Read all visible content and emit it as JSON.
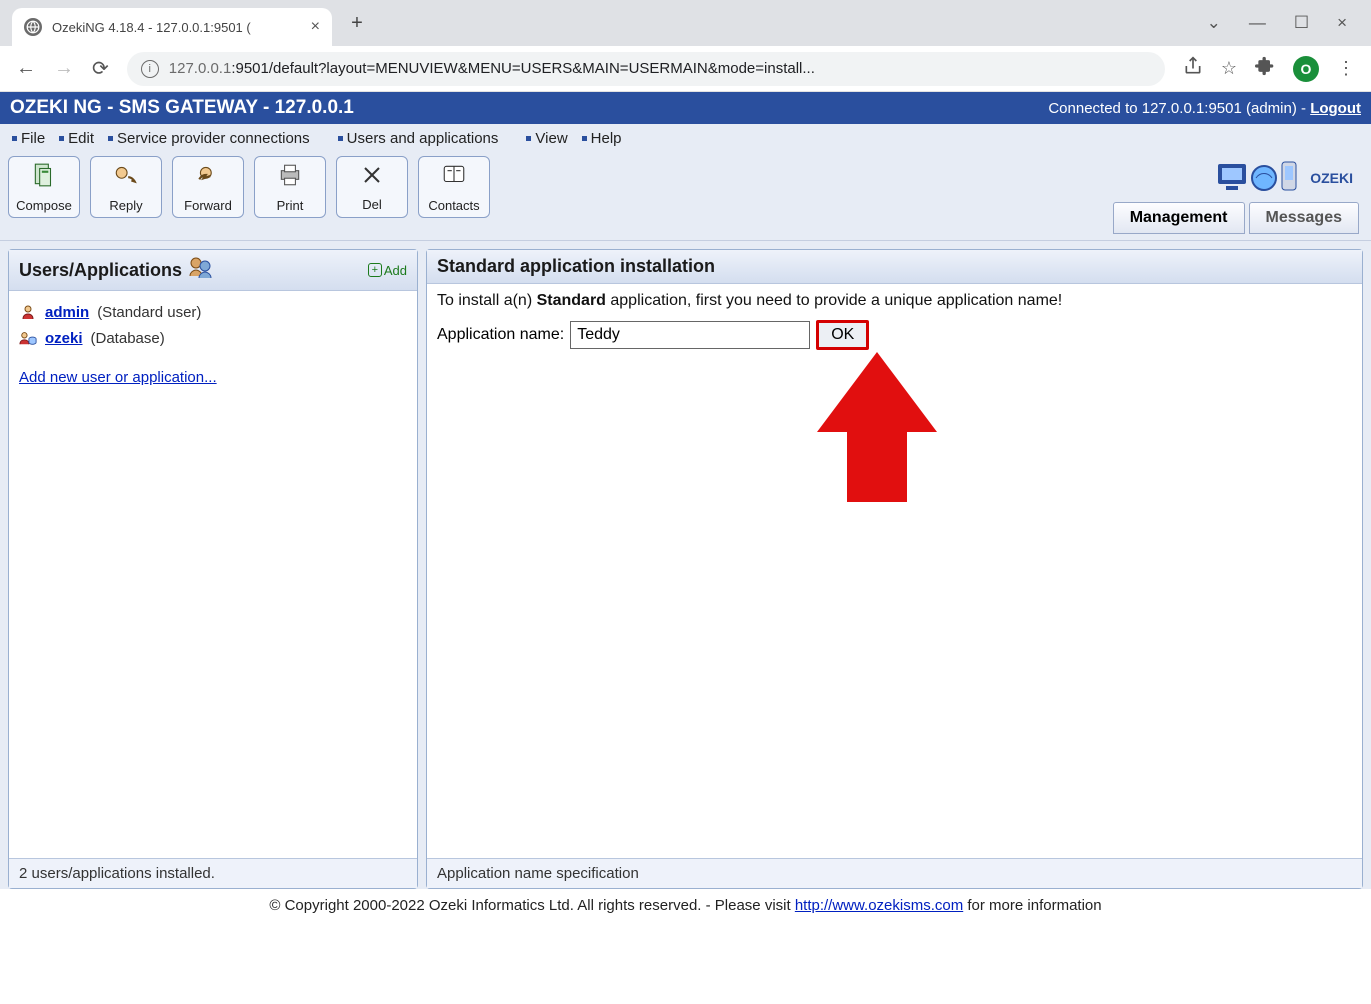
{
  "browser": {
    "tab_title": "OzekiNG 4.18.4 - 127.0.0.1:9501 (",
    "url_host": "127.0.0.1",
    "url_rest": ":9501/default?layout=MENUVIEW&MENU=USERS&MAIN=USERMAIN&mode=install...",
    "avatar_letter": "O"
  },
  "app_header": {
    "title": "OZEKI NG - SMS GATEWAY - 127.0.0.1",
    "status_prefix": "Connected to 127.0.0.1:9501 (admin) - ",
    "logout": "Logout"
  },
  "menu": {
    "items": [
      "File",
      "Edit",
      "Service provider connections",
      "Users and applications",
      "View",
      "Help"
    ]
  },
  "toolbar": {
    "compose": "Compose",
    "reply": "Reply",
    "forward": "Forward",
    "print": "Print",
    "del": "Del",
    "contacts": "Contacts"
  },
  "logo": {
    "text": "OZEKI"
  },
  "tabs": {
    "management": "Management",
    "messages": "Messages"
  },
  "left_panel": {
    "title": "Users/Applications",
    "add_label": "Add",
    "users": [
      {
        "name": "admin",
        "desc": "(Standard user)"
      },
      {
        "name": "ozeki",
        "desc": "(Database)"
      }
    ],
    "add_new": "Add new user or application...",
    "footer": "2 users/applications installed."
  },
  "right_panel": {
    "title": "Standard application installation",
    "intro_before": "To install a(n) ",
    "intro_bold": "Standard",
    "intro_after": " application, first you need to provide a unique application name!",
    "field_label": "Application name:",
    "field_value": "Teddy",
    "ok": "OK",
    "footer": "Application name specification"
  },
  "page_footer": {
    "text_before": "© Copyright 2000-2022 Ozeki Informatics Ltd. All rights reserved. - Please visit ",
    "link": "http://www.ozekisms.com",
    "text_after": " for more information"
  }
}
